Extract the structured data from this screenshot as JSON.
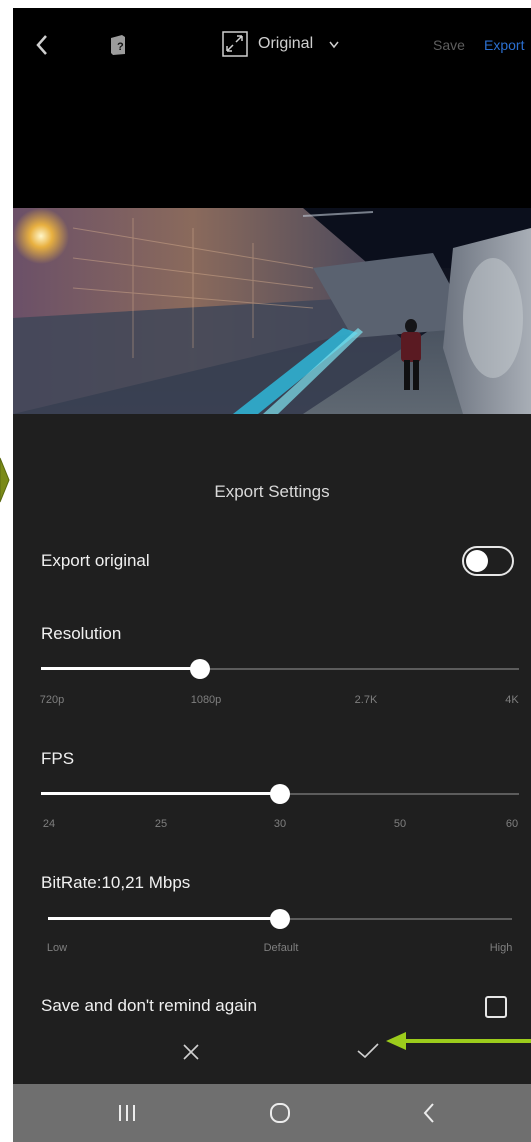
{
  "topbar": {
    "back_icon": "back-arrow-icon",
    "help_icon": "help-book-icon",
    "aspect_icon": "expand-icon",
    "aspect_label": "Original",
    "save_label": "Save",
    "export_label": "Export"
  },
  "sheet": {
    "title": "Export Settings",
    "export_original_label": "Export original",
    "export_original_enabled": false,
    "resolution": {
      "label": "Resolution",
      "ticks": [
        "720p",
        "1080p",
        "2.7K",
        "4K"
      ],
      "selected": "1080p"
    },
    "fps": {
      "label": "FPS",
      "ticks": [
        "24",
        "25",
        "30",
        "50",
        "60"
      ],
      "selected": "30"
    },
    "bitrate": {
      "label": "BitRate:10,21 Mbps",
      "ticks": [
        "Low",
        "Default",
        "High"
      ],
      "selected": "Default"
    },
    "remember_label": "Save and don't remind again",
    "remember_checked": false,
    "cancel_icon": "close-icon",
    "confirm_icon": "checkmark-icon"
  },
  "nav": {
    "recents_icon": "recents-icon",
    "home_icon": "home-icon",
    "back_icon": "back-chevron-icon"
  },
  "colors": {
    "sheet_bg": "#1f1f1f",
    "accent_blue": "#2b6fd0",
    "annotation_green": "#9ccc1c"
  }
}
